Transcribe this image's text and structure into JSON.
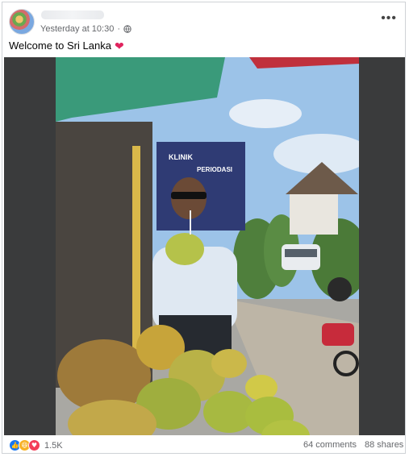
{
  "post": {
    "timestamp": "Yesterday at 10:30",
    "audience_icon": "globe-icon",
    "more_label": "•••",
    "caption": "Welcome to Sri Lanka",
    "caption_emoji": "❤"
  },
  "photo": {
    "sign_line1": "KLINIK",
    "sign_line2": "PERIODASI"
  },
  "engagement": {
    "reactions": [
      "like",
      "haha",
      "love"
    ],
    "reaction_icons": {
      "like": "👍",
      "haha": "😆",
      "love": "♥"
    },
    "reaction_colors": {
      "like": "#1877f2",
      "haha": "#f7b125",
      "love": "#f33e58"
    },
    "reaction_count": "1.5K",
    "comments": "64 comments",
    "shares": "88 shares"
  }
}
